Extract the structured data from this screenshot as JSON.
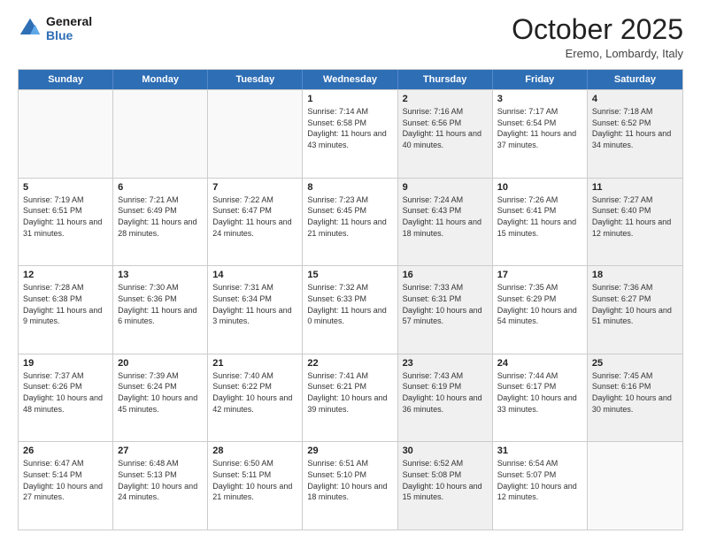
{
  "header": {
    "logo_line1": "General",
    "logo_line2": "Blue",
    "month_title": "October 2025",
    "location": "Eremo, Lombardy, Italy"
  },
  "weekdays": [
    "Sunday",
    "Monday",
    "Tuesday",
    "Wednesday",
    "Thursday",
    "Friday",
    "Saturday"
  ],
  "rows": [
    [
      {
        "day": "",
        "info": "",
        "bg": "empty"
      },
      {
        "day": "",
        "info": "",
        "bg": "empty"
      },
      {
        "day": "",
        "info": "",
        "bg": "empty"
      },
      {
        "day": "1",
        "info": "Sunrise: 7:14 AM\nSunset: 6:58 PM\nDaylight: 11 hours and 43 minutes.",
        "bg": ""
      },
      {
        "day": "2",
        "info": "Sunrise: 7:16 AM\nSunset: 6:56 PM\nDaylight: 11 hours and 40 minutes.",
        "bg": "gray"
      },
      {
        "day": "3",
        "info": "Sunrise: 7:17 AM\nSunset: 6:54 PM\nDaylight: 11 hours and 37 minutes.",
        "bg": ""
      },
      {
        "day": "4",
        "info": "Sunrise: 7:18 AM\nSunset: 6:52 PM\nDaylight: 11 hours and 34 minutes.",
        "bg": "gray"
      }
    ],
    [
      {
        "day": "5",
        "info": "Sunrise: 7:19 AM\nSunset: 6:51 PM\nDaylight: 11 hours and 31 minutes.",
        "bg": ""
      },
      {
        "day": "6",
        "info": "Sunrise: 7:21 AM\nSunset: 6:49 PM\nDaylight: 11 hours and 28 minutes.",
        "bg": ""
      },
      {
        "day": "7",
        "info": "Sunrise: 7:22 AM\nSunset: 6:47 PM\nDaylight: 11 hours and 24 minutes.",
        "bg": ""
      },
      {
        "day": "8",
        "info": "Sunrise: 7:23 AM\nSunset: 6:45 PM\nDaylight: 11 hours and 21 minutes.",
        "bg": ""
      },
      {
        "day": "9",
        "info": "Sunrise: 7:24 AM\nSunset: 6:43 PM\nDaylight: 11 hours and 18 minutes.",
        "bg": "gray"
      },
      {
        "day": "10",
        "info": "Sunrise: 7:26 AM\nSunset: 6:41 PM\nDaylight: 11 hours and 15 minutes.",
        "bg": ""
      },
      {
        "day": "11",
        "info": "Sunrise: 7:27 AM\nSunset: 6:40 PM\nDaylight: 11 hours and 12 minutes.",
        "bg": "gray"
      }
    ],
    [
      {
        "day": "12",
        "info": "Sunrise: 7:28 AM\nSunset: 6:38 PM\nDaylight: 11 hours and 9 minutes.",
        "bg": ""
      },
      {
        "day": "13",
        "info": "Sunrise: 7:30 AM\nSunset: 6:36 PM\nDaylight: 11 hours and 6 minutes.",
        "bg": ""
      },
      {
        "day": "14",
        "info": "Sunrise: 7:31 AM\nSunset: 6:34 PM\nDaylight: 11 hours and 3 minutes.",
        "bg": ""
      },
      {
        "day": "15",
        "info": "Sunrise: 7:32 AM\nSunset: 6:33 PM\nDaylight: 11 hours and 0 minutes.",
        "bg": ""
      },
      {
        "day": "16",
        "info": "Sunrise: 7:33 AM\nSunset: 6:31 PM\nDaylight: 10 hours and 57 minutes.",
        "bg": "gray"
      },
      {
        "day": "17",
        "info": "Sunrise: 7:35 AM\nSunset: 6:29 PM\nDaylight: 10 hours and 54 minutes.",
        "bg": ""
      },
      {
        "day": "18",
        "info": "Sunrise: 7:36 AM\nSunset: 6:27 PM\nDaylight: 10 hours and 51 minutes.",
        "bg": "gray"
      }
    ],
    [
      {
        "day": "19",
        "info": "Sunrise: 7:37 AM\nSunset: 6:26 PM\nDaylight: 10 hours and 48 minutes.",
        "bg": ""
      },
      {
        "day": "20",
        "info": "Sunrise: 7:39 AM\nSunset: 6:24 PM\nDaylight: 10 hours and 45 minutes.",
        "bg": ""
      },
      {
        "day": "21",
        "info": "Sunrise: 7:40 AM\nSunset: 6:22 PM\nDaylight: 10 hours and 42 minutes.",
        "bg": ""
      },
      {
        "day": "22",
        "info": "Sunrise: 7:41 AM\nSunset: 6:21 PM\nDaylight: 10 hours and 39 minutes.",
        "bg": ""
      },
      {
        "day": "23",
        "info": "Sunrise: 7:43 AM\nSunset: 6:19 PM\nDaylight: 10 hours and 36 minutes.",
        "bg": "gray"
      },
      {
        "day": "24",
        "info": "Sunrise: 7:44 AM\nSunset: 6:17 PM\nDaylight: 10 hours and 33 minutes.",
        "bg": ""
      },
      {
        "day": "25",
        "info": "Sunrise: 7:45 AM\nSunset: 6:16 PM\nDaylight: 10 hours and 30 minutes.",
        "bg": "gray"
      }
    ],
    [
      {
        "day": "26",
        "info": "Sunrise: 6:47 AM\nSunset: 5:14 PM\nDaylight: 10 hours and 27 minutes.",
        "bg": ""
      },
      {
        "day": "27",
        "info": "Sunrise: 6:48 AM\nSunset: 5:13 PM\nDaylight: 10 hours and 24 minutes.",
        "bg": ""
      },
      {
        "day": "28",
        "info": "Sunrise: 6:50 AM\nSunset: 5:11 PM\nDaylight: 10 hours and 21 minutes.",
        "bg": ""
      },
      {
        "day": "29",
        "info": "Sunrise: 6:51 AM\nSunset: 5:10 PM\nDaylight: 10 hours and 18 minutes.",
        "bg": ""
      },
      {
        "day": "30",
        "info": "Sunrise: 6:52 AM\nSunset: 5:08 PM\nDaylight: 10 hours and 15 minutes.",
        "bg": "gray"
      },
      {
        "day": "31",
        "info": "Sunrise: 6:54 AM\nSunset: 5:07 PM\nDaylight: 10 hours and 12 minutes.",
        "bg": ""
      },
      {
        "day": "",
        "info": "",
        "bg": "empty"
      }
    ]
  ]
}
